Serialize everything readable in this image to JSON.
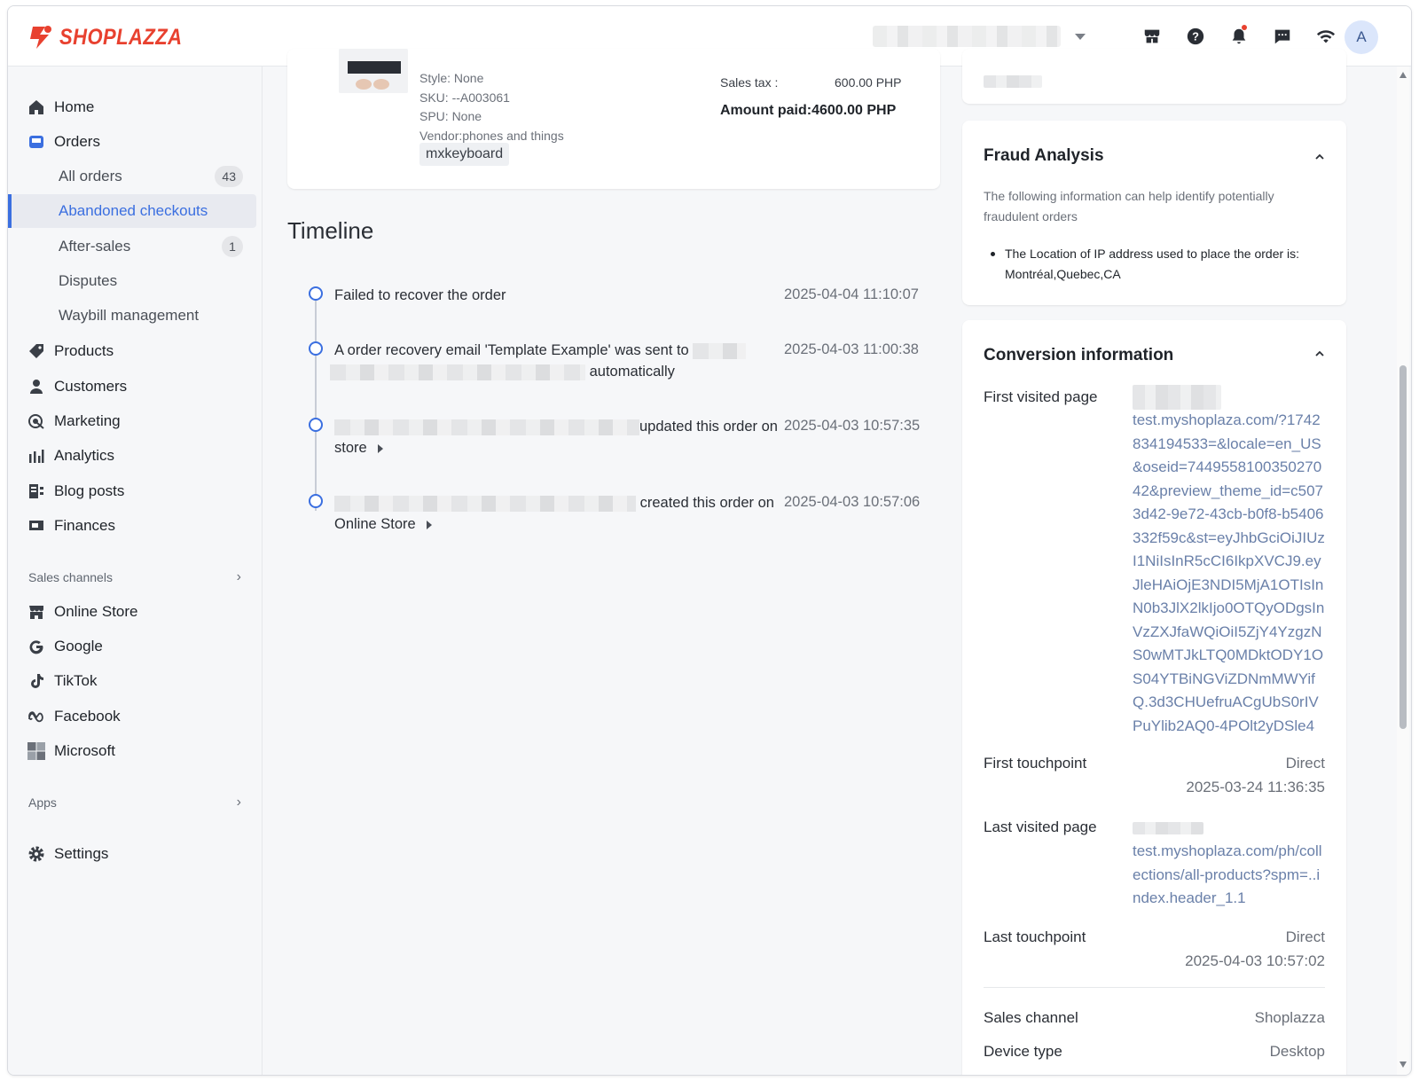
{
  "brand": {
    "name": "SHOPLAZZA",
    "accent": "#e8412f",
    "primary": "#3b6fe0"
  },
  "topbar": {
    "icons": [
      "store-icon",
      "help-icon",
      "bell-icon",
      "message-icon",
      "wifi-icon"
    ],
    "avatar": "A"
  },
  "sidebar": {
    "home": "Home",
    "orders": "Orders",
    "all_orders": "All orders",
    "all_orders_count": "43",
    "abandoned": "Abandoned checkouts",
    "after_sales": "After-sales",
    "after_sales_count": "1",
    "disputes": "Disputes",
    "waybill": "Waybill management",
    "products": "Products",
    "customers": "Customers",
    "marketing": "Marketing",
    "analytics": "Analytics",
    "blog": "Blog posts",
    "finances": "Finances",
    "sales_channels": "Sales channels",
    "online_store": "Online Store",
    "google": "Google",
    "tiktok": "TikTok",
    "facebook": "Facebook",
    "microsoft": "Microsoft",
    "apps": "Apps",
    "settings": "Settings"
  },
  "product": {
    "style": "Style: None",
    "sku": "SKU: --A003061",
    "spu": "SPU: None",
    "vendor": "Vendor:phones and things",
    "tag": "mxkeyboard",
    "sales_tax_label": "Sales tax :",
    "sales_tax_value": "600.00 PHP",
    "amount_paid": "Amount paid:4600.00 PHP"
  },
  "timeline": {
    "title": "Timeline",
    "events": [
      {
        "text": "Failed to recover the order",
        "time": "2025-04-04 11:10:07"
      },
      {
        "text": "A order recovery email 'Template Example' was sent to",
        "text2": "automatically",
        "time": "2025-04-03 11:00:38"
      },
      {
        "text": "updated this order on",
        "text2": "store",
        "time": "2025-04-03 10:57:35"
      },
      {
        "text": "created this order on",
        "text2": "Online Store",
        "time": "2025-04-03 10:57:06"
      }
    ]
  },
  "fraud": {
    "title": "Fraud Analysis",
    "description": "The following information can help identify potentially fraudulent orders",
    "bullet": "The Location of IP address used to place the order is: Montréal,Quebec,CA"
  },
  "conversion": {
    "title": "Conversion information",
    "first_visited_label": "First visited page",
    "first_visited_url": "test.myshoplaza.com/?1742834194533=&locale=en_US&oseid=744955810035027042&preview_theme_id=c5073d42-9e72-43cb-b0f8-b5406332f59c&st=eyJhbGciOiJIUzI1NiIsInR5cCI6IkpXVCJ9.eyJleHAiOjE3NDI5MjA1OTIsInN0b3JlX2lkIjo0OTQyODgsInVzZXJfaWQiOiI5ZjY4YzgzNS0wMTJkLTQ0MDktODY1OS04YTBiNGViZDNmMWYifQ.3d3CHUefruACgUbS0rIVPuYlib2AQ0-4POlt2yDSle4",
    "first_touch_label": "First touchpoint",
    "first_touch_value": "Direct",
    "first_touch_time": "2025-03-24 11:36:35",
    "last_visited_label": "Last visited page",
    "last_visited_url": "test.myshoplaza.com/ph/collections/all-products?spm=..index.header_1.1",
    "last_touch_label": "Last touchpoint",
    "last_touch_value": "Direct",
    "last_touch_time": "2025-04-03 10:57:02",
    "sales_channel_label": "Sales channel",
    "sales_channel_value": "Shoplazza",
    "device_label": "Device type",
    "device_value": "Desktop"
  }
}
